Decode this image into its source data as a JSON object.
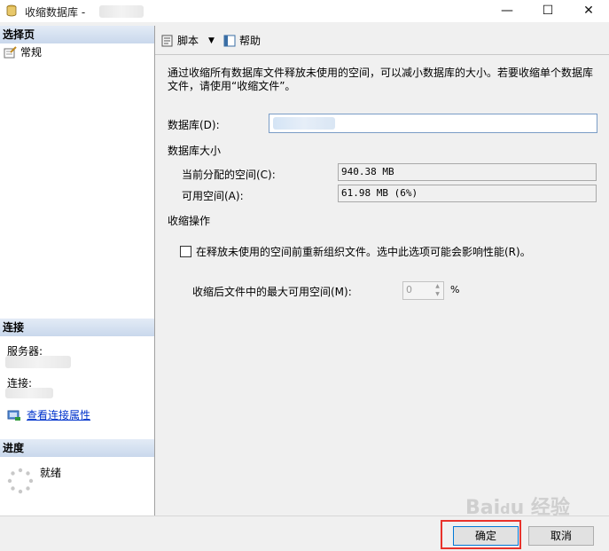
{
  "window": {
    "title": "收缩数据库 -",
    "minimize": "—",
    "maximize": "☐",
    "close": "✕"
  },
  "sidebar": {
    "select_page_header": "选择页",
    "pages": [
      {
        "label": "常规"
      }
    ],
    "connection_header": "连接",
    "server_label": "服务器:",
    "connection_label": "连接:",
    "view_connection_link": "查看连接属性",
    "progress_header": "进度",
    "progress_status": "就绪"
  },
  "toolbar": {
    "script_label": "脚本",
    "script_dropdown": "▼",
    "help_label": "帮助"
  },
  "main": {
    "description": "通过收缩所有数据库文件释放未使用的空间，可以减小数据库的大小。若要收缩单个数据库文件，请使用“收缩文件”。",
    "database_label": "数据库(D):",
    "database_size_header": "数据库大小",
    "allocated_label": "当前分配的空间(C):",
    "allocated_value": "940.38 MB",
    "available_label": "可用空间(A):",
    "available_value": "61.98 MB (6%)",
    "shrink_action_header": "收缩操作",
    "reorganize_checkbox_label": "在释放未使用的空间前重新组织文件。选中此选项可能会影响性能(R)。",
    "reorganize_checked": false,
    "max_free_label": "收缩后文件中的最大可用空间(M):",
    "max_free_value": "0",
    "max_free_unit": "%"
  },
  "buttons": {
    "ok": "确定",
    "cancel": "取消"
  },
  "colors": {
    "accent_highlight": "#e8322b",
    "link": "#0033cc"
  }
}
